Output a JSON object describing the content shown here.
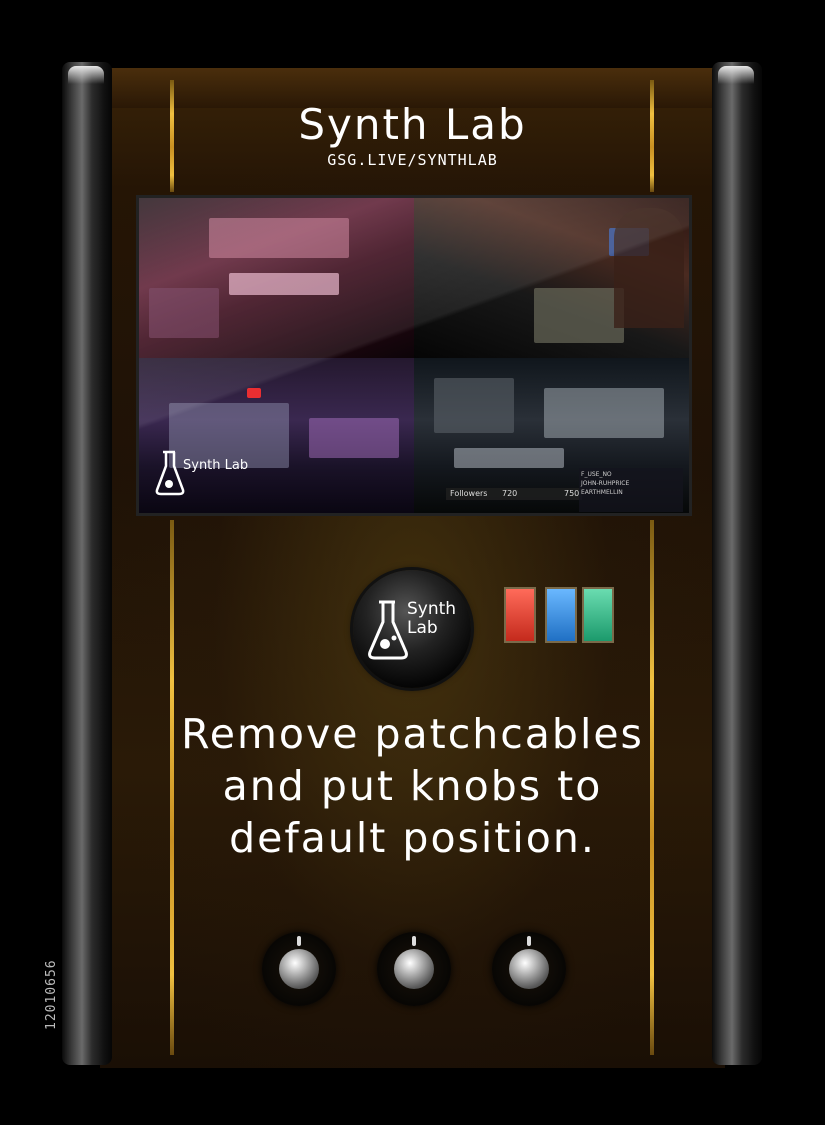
{
  "card": {
    "title": "Synth Lab",
    "url": "GSG.LIVE/SYNTHLAB",
    "instruction": "Remove patchcables and put knobs to default position.",
    "card_id": "12010656"
  },
  "screen": {
    "watermark_logo_text": "Synth Lab",
    "followers_label": "Followers",
    "followers_value_1": "720",
    "followers_value_2": "750",
    "chat_lines": [
      "F_USE_NO",
      "JOHN-RUHPRICE",
      "EARTHMELLIN"
    ]
  },
  "logo_button": {
    "text": "Synth Lab"
  },
  "switches": [
    {
      "color": "#e8493a"
    },
    {
      "color": "#3d93e6"
    },
    {
      "color": "#35b98a"
    }
  ],
  "knobs_count": 3
}
